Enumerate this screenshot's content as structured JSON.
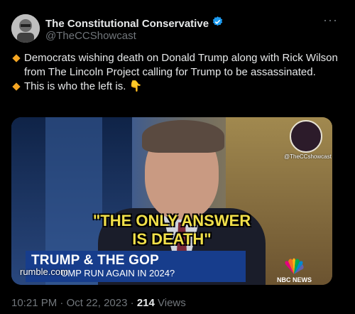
{
  "author": {
    "display_name": "The Constitutional Conservative",
    "handle": "@TheCCShowcast",
    "verified": true,
    "verified_color": "#1d9bf0"
  },
  "more_label": "···",
  "tweet": {
    "line1": "Democrats wishing death on Donald Trump along with Rick Wilson from The Lincoln Project calling for Trump to be assassinated.",
    "line2": "This is who the left is. 👇"
  },
  "media": {
    "quote_line1": "\"THE ONLY ANSWER",
    "quote_line2": "IS DEATH\"",
    "chyron_title": "TRUMP & THE GOP",
    "chyron_sub": "UMP RUN AGAIN IN 2024?",
    "source_label": "rumble.com",
    "network_label": "NBC NEWS",
    "watermark_handle": "@TheCCshowcast"
  },
  "footer": {
    "time": "10:21 PM",
    "separator": "·",
    "date": "Oct 22, 2023",
    "views_count": "214",
    "views_label": "Views"
  },
  "icons": {
    "bullet": "orange-diamond-icon",
    "verified": "verified-badge-icon",
    "more": "more-options-icon"
  }
}
